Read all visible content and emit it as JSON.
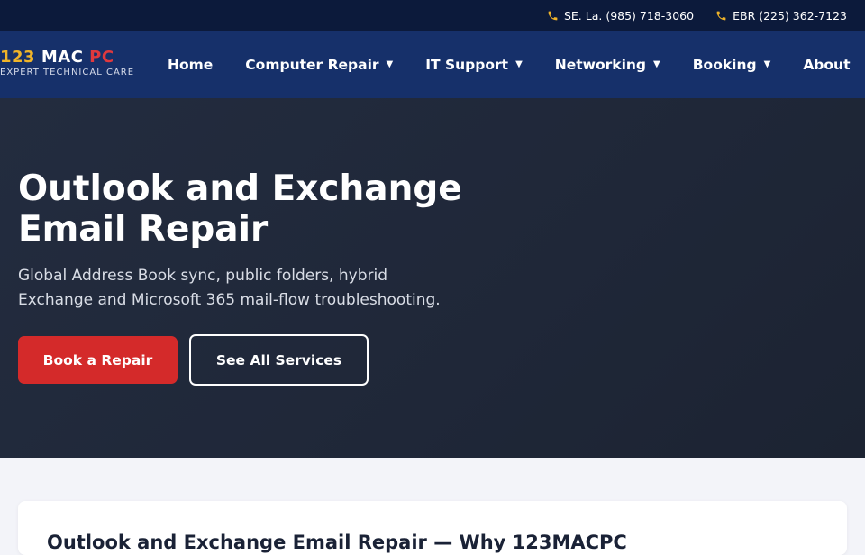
{
  "topbar": {
    "phones": [
      {
        "icon": "phone-icon",
        "label": "SE. La. (985) 718-3060"
      },
      {
        "icon": "phone-icon",
        "label": "EBR (225) 362-7123"
      }
    ]
  },
  "brand": {
    "part1": "123",
    "part2": " MAC ",
    "part3": "PC",
    "tagline": "EXPERT TECHNICAL CARE"
  },
  "nav": {
    "items": [
      {
        "label": "Home",
        "dropdown": false
      },
      {
        "label": "Computer Repair",
        "dropdown": true
      },
      {
        "label": "IT Support",
        "dropdown": true
      },
      {
        "label": "Networking",
        "dropdown": true
      },
      {
        "label": "Booking",
        "dropdown": true
      },
      {
        "label": "About",
        "dropdown": false
      }
    ],
    "caret": "▼"
  },
  "hero": {
    "title": "Outlook and Exchange Email Repair",
    "subtitle": "Global Address Book sync, public folders, hybrid Exchange and Microsoft 365 mail-flow troubleshooting.",
    "primary_button": "Book a Repair",
    "secondary_button": "See All Services"
  },
  "section": {
    "heading": "Outlook and Exchange Email Repair — Why 123MACPC"
  },
  "colors": {
    "topbar_bg": "#0c1a3b",
    "nav_bg": "#16306a",
    "accent_yellow": "#f0b429",
    "accent_red": "#d42a2a",
    "hero_bg": "#1f2738"
  }
}
